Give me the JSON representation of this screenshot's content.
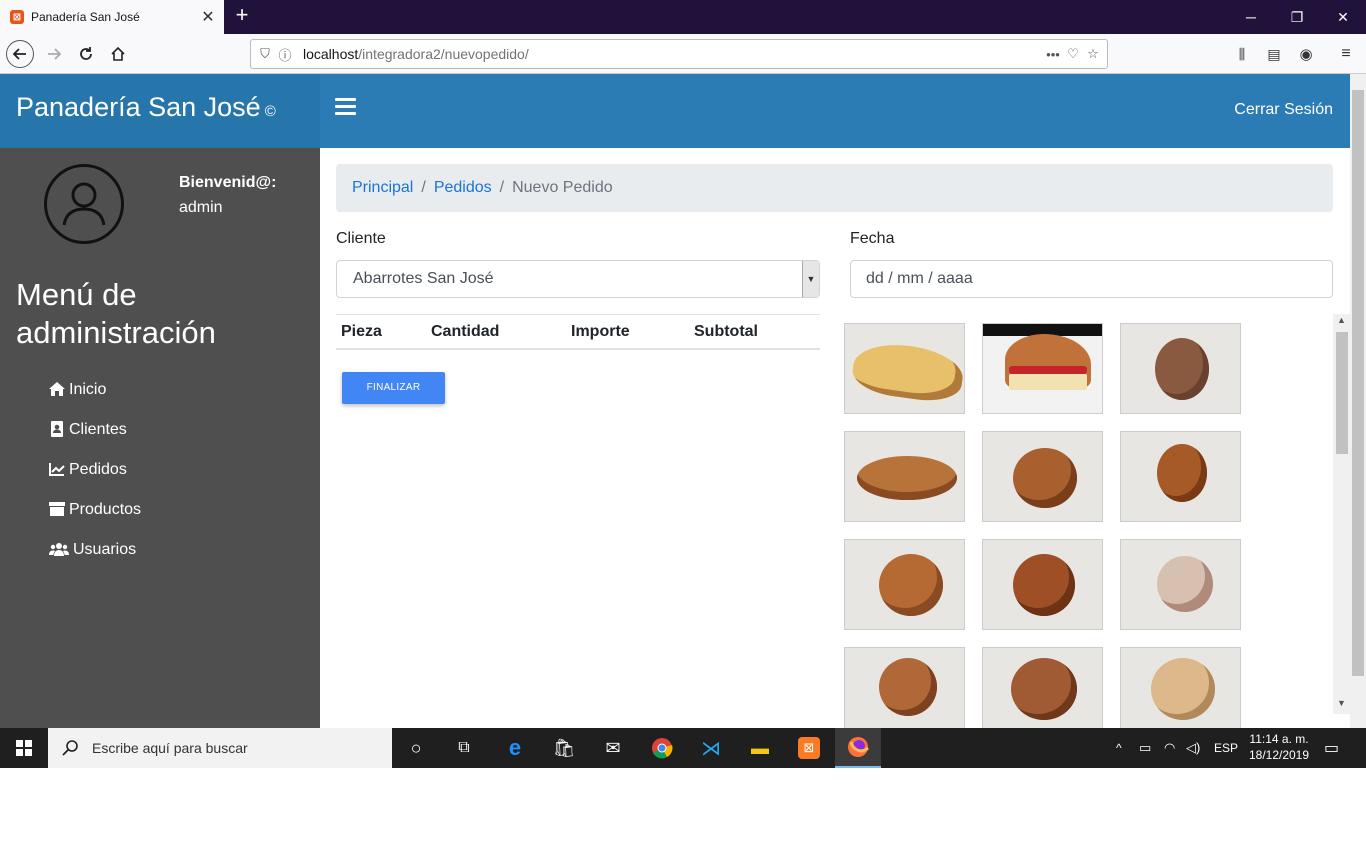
{
  "browser": {
    "tab_title": "Panadería San José",
    "tab_close": "✕",
    "new_tab": "+",
    "url_host": "localhost",
    "url_path": "/integradora2/nuevopedido/",
    "window_controls": [
      "─",
      "❐",
      "✕"
    ]
  },
  "header": {
    "brand": "Panadería San José",
    "brand_mark": "©",
    "logout": "Cerrar Sesión"
  },
  "sidebar": {
    "welcome": "Bienvenid@:",
    "username": "admin",
    "menu_title": "Menú de administración",
    "items": [
      {
        "label": "Inicio",
        "icon": "home-icon"
      },
      {
        "label": "Clientes",
        "icon": "address-book-icon"
      },
      {
        "label": "Pedidos",
        "icon": "chart-line-icon"
      },
      {
        "label": "Productos",
        "icon": "box-icon"
      },
      {
        "label": "Usuarios",
        "icon": "users-icon"
      }
    ]
  },
  "breadcrumb": {
    "items": [
      "Principal",
      "Pedidos"
    ],
    "separator": "/",
    "active": "Nuevo Pedido"
  },
  "form": {
    "client_label": "Cliente",
    "client_value": "Abarrotes San José",
    "date_label": "Fecha",
    "date_placeholder": "dd / mm / aaaa"
  },
  "table": {
    "headers": [
      "Pieza",
      "Cantidad",
      "Importe",
      "Subtotal"
    ]
  },
  "actions": {
    "finalize": "FINALIZAR"
  },
  "taskbar": {
    "search_placeholder": "Escribe aquí para buscar",
    "language": "ESP",
    "time": "11:14 a. m.",
    "date": "18/12/2019"
  }
}
